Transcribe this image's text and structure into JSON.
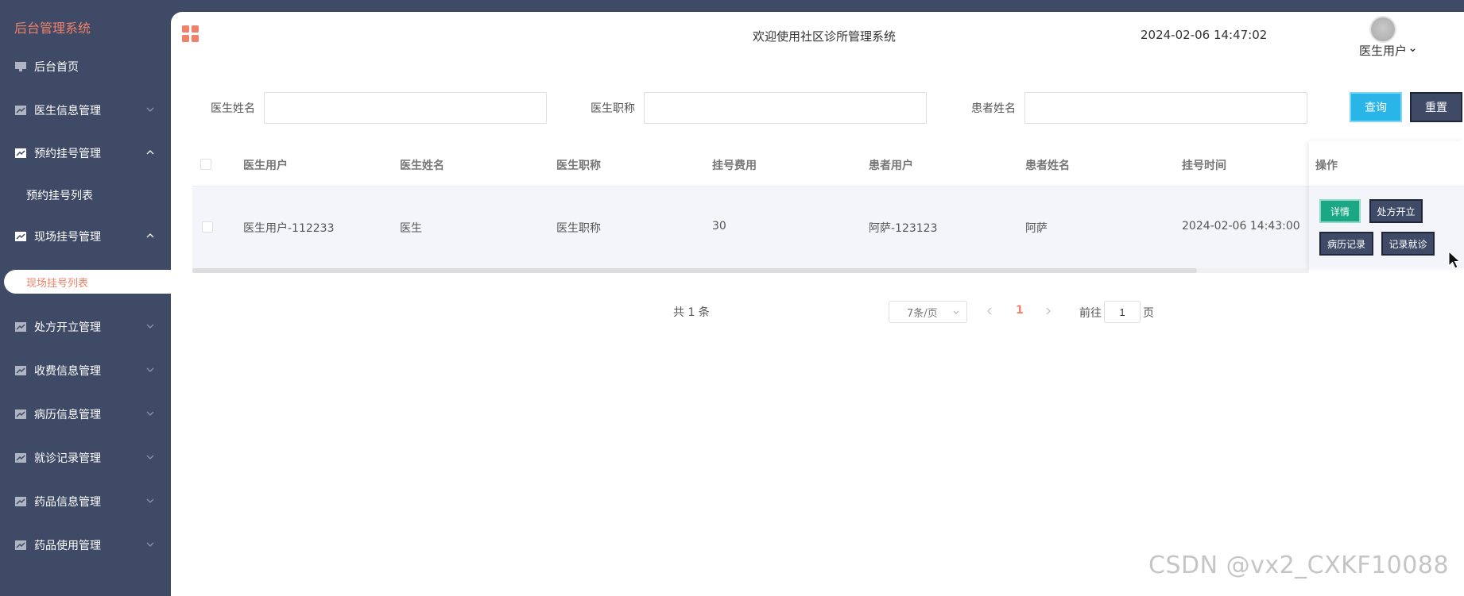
{
  "app": {
    "brand": "后台管理系统"
  },
  "sidebar": {
    "items": [
      {
        "label": "后台首页"
      },
      {
        "label": "医生信息管理"
      },
      {
        "label": "预约挂号管理"
      },
      {
        "label": "预约挂号列表"
      },
      {
        "label": "现场挂号管理"
      },
      {
        "label": "现场挂号列表"
      },
      {
        "label": "处方开立管理"
      },
      {
        "label": "收费信息管理"
      },
      {
        "label": "病历信息管理"
      },
      {
        "label": "就诊记录管理"
      },
      {
        "label": "药品信息管理"
      },
      {
        "label": "药品使用管理"
      }
    ]
  },
  "header": {
    "welcome": "欢迎使用社区诊所管理系统",
    "datetime": "2024-02-06 14:47:02",
    "user": "医生用户"
  },
  "search": {
    "doctor_name_label": "医生姓名",
    "doctor_title_label": "医生职称",
    "patient_name_label": "患者姓名",
    "doctor_name_value": "",
    "doctor_title_value": "",
    "patient_name_value": "",
    "query_label": "查询",
    "reset_label": "重置"
  },
  "table": {
    "columns": [
      "医生用户",
      "医生姓名",
      "医生职称",
      "挂号费用",
      "患者用户",
      "患者姓名",
      "挂号时间",
      "操作"
    ],
    "rows": [
      [
        "医生用户-112233",
        "医生",
        "医生职称",
        "30",
        "阿萨-123123",
        "阿萨",
        "2024-02-06 14:43:00"
      ]
    ],
    "actions": {
      "detail": "详情",
      "prescribe": "处方开立",
      "medical_record": "病历记录",
      "record_visit": "记录就诊"
    }
  },
  "pagination": {
    "total": "共 1 条",
    "page_size": "7条/页",
    "current_page": "1",
    "goto_label": "前往",
    "goto_value": "1",
    "goto_unit": "页"
  },
  "watermark": "CSDN @vx2_CXKF10088",
  "colors": {
    "accent": "#f0826a",
    "sidebar_bg": "#3e4a66",
    "query_btn": "#29b5e8",
    "detail_btn": "#1ba784"
  }
}
